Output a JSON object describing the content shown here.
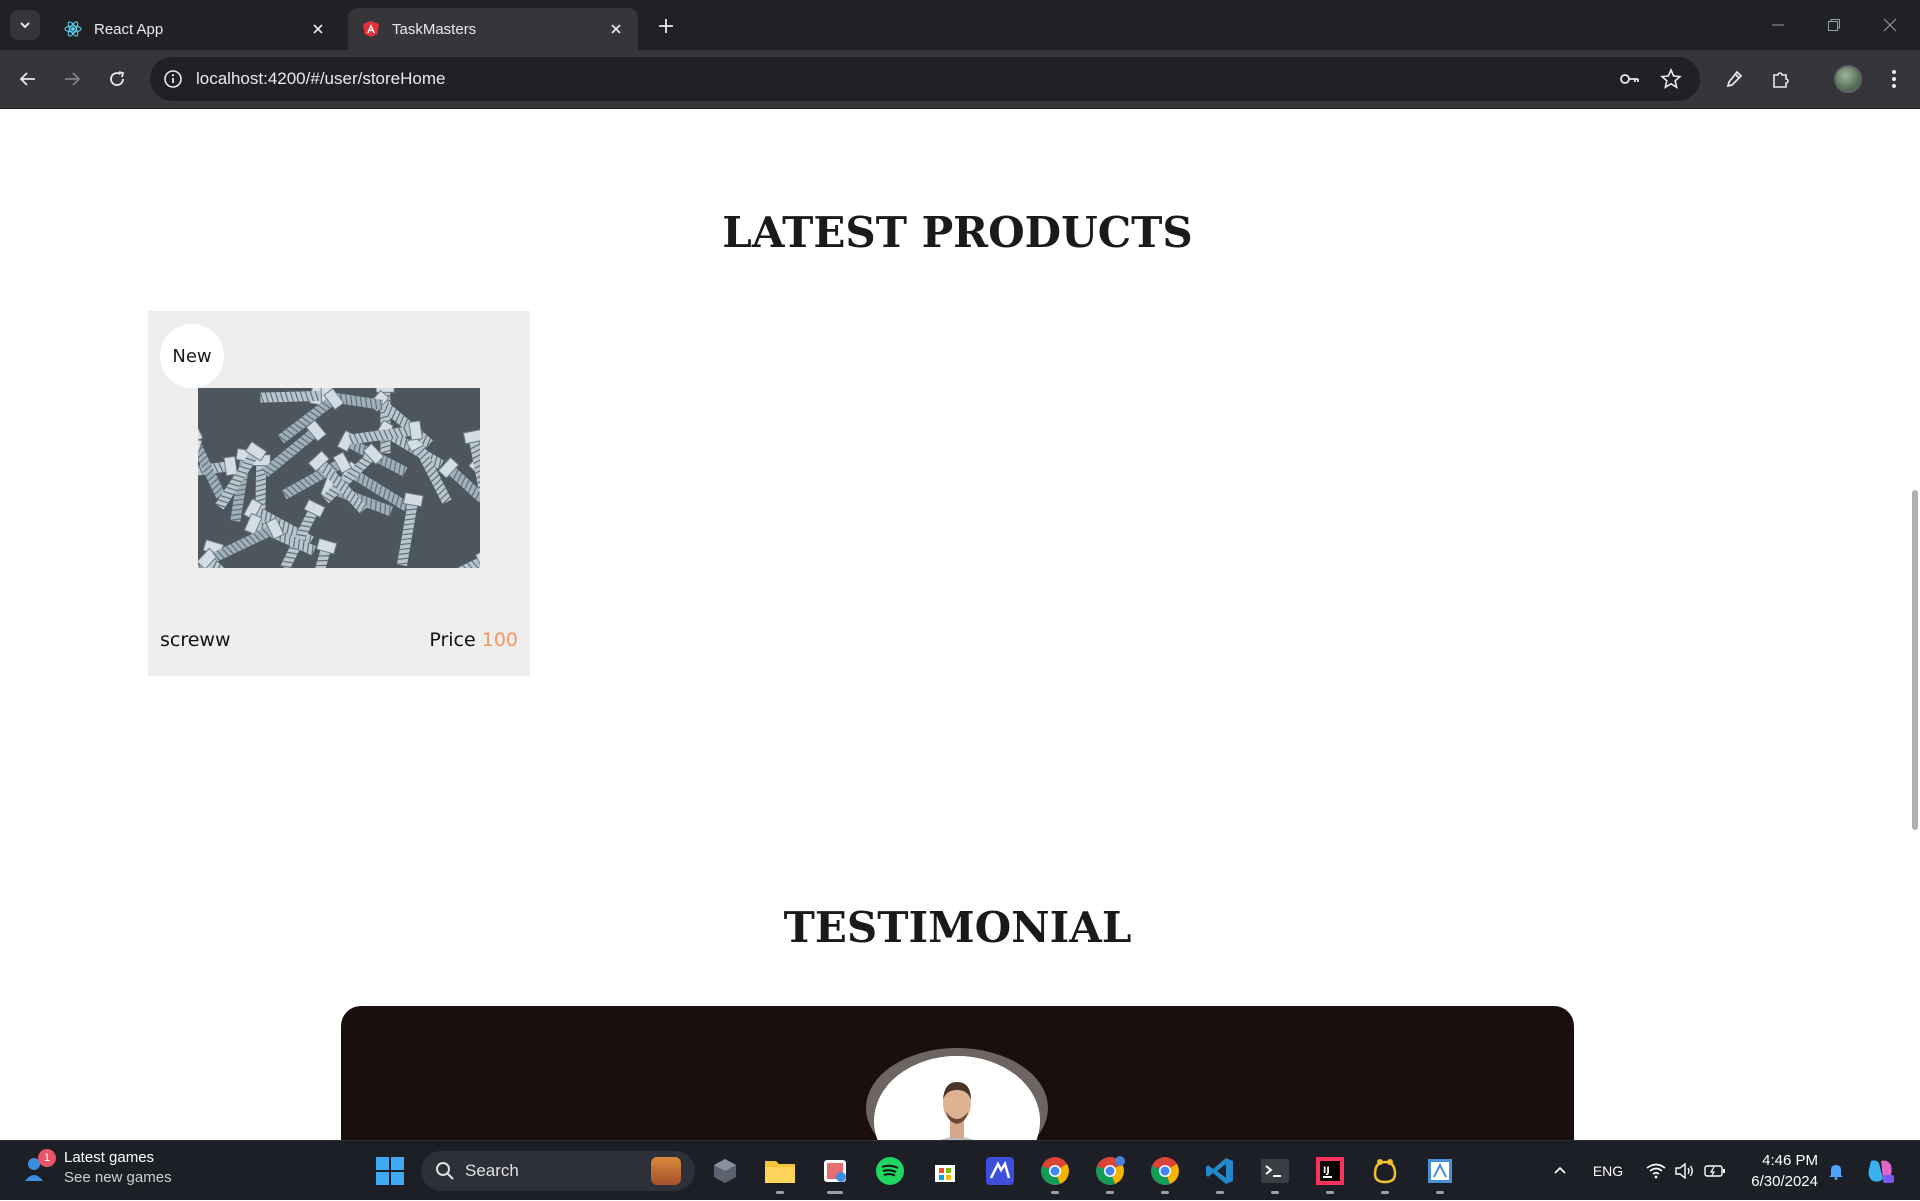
{
  "browser": {
    "tabs": [
      {
        "title": "React App",
        "active": false,
        "favicon": "react-icon"
      },
      {
        "title": "TaskMasters",
        "active": true,
        "favicon": "angular-icon"
      }
    ],
    "address": "localhost:4200/#/user/storeHome"
  },
  "page": {
    "latest_products_title": "LATEST PRODUCTS",
    "products": [
      {
        "badge": "New",
        "name": "screww",
        "price_label": "Price",
        "price_value": "100"
      }
    ],
    "testimonial_title": "TESTIMONIAL",
    "colors": {
      "price": "#f7955f",
      "testimonial_bg": "#1b0f0d",
      "card_bg": "#eeeeee"
    }
  },
  "taskbar": {
    "widget": {
      "badge": "1",
      "title": "Latest games",
      "subtitle": "See new games"
    },
    "search_label": "Search",
    "apps": [
      "windows-start-icon",
      "search",
      "task-view-icon",
      "file-explorer-icon",
      "snipping-tool-icon",
      "spotify-icon",
      "microsoft-store-icon",
      "app-icon",
      "chrome-icon",
      "chrome-icon",
      "chrome-icon",
      "vscode-icon",
      "terminal-icon",
      "intellij-icon",
      "tool-icon",
      "app-icon"
    ],
    "language": "ENG",
    "time": "4:46 PM",
    "date": "6/30/2024"
  }
}
